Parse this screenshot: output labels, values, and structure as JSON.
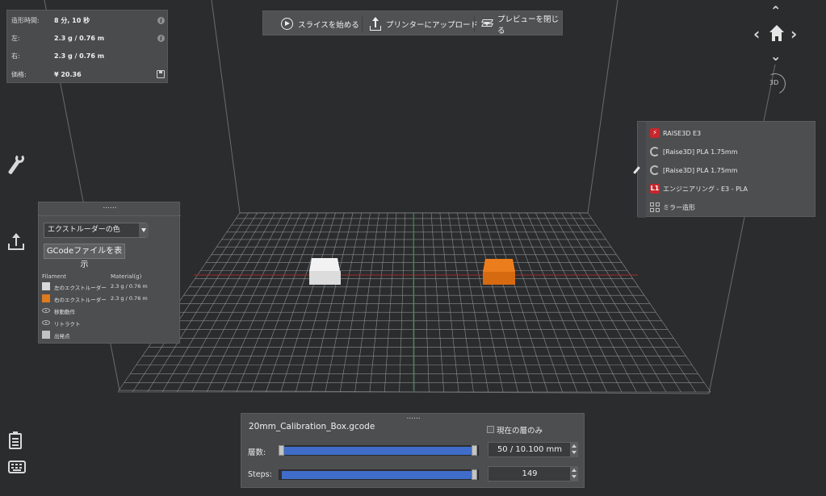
{
  "stats": {
    "rows": [
      {
        "label": "造形時間:",
        "value": "8 分, 10 秒",
        "icon": "info-icon"
      },
      {
        "label": "左:",
        "value": "2.3 g / 0.76 m",
        "icon": "info-icon"
      },
      {
        "label": "右:",
        "value": "2.3 g / 0.76 m",
        "icon": ""
      },
      {
        "label": "価格:",
        "value": "¥ 20.36",
        "icon": "save-icon"
      }
    ]
  },
  "toolbar": {
    "slice_label": "スライスを始める",
    "upload_label": "プリンターにアップロード",
    "close_preview_label": "プレビューを閉じる"
  },
  "profiles": {
    "printer": "RAISE3D E3",
    "left_filament": "[Raise3D] PLA 1.75mm",
    "right_filament": "[Raise3D] PLA 1.75mm",
    "template": "エンジニアリング - E3 - PLA",
    "template_badge": "L1",
    "mode": "ミラー造形"
  },
  "color_panel": {
    "drag_handle": "......",
    "dropdown_value": "エクストルーダーの色",
    "gcode_button": "GCodeファイルを表示",
    "header_filament": "Filament",
    "header_material": "Material(g)",
    "rows": [
      {
        "name": "左のエクストルーダー",
        "material": "2.3 g / 0.76 m",
        "swatch": "#d8d8d8"
      },
      {
        "name": "右のエクストルーダー",
        "material": "2.3 g / 0.76 m",
        "swatch": "#e07a1e"
      },
      {
        "name": "移動動作",
        "material": "",
        "swatch": "eye"
      },
      {
        "name": "リトラクト",
        "material": "",
        "swatch": "eye"
      },
      {
        "name": "出発点",
        "material": "",
        "swatch": "#c2c2c2"
      }
    ]
  },
  "layer_panel": {
    "drag_handle": "......",
    "filename": "20mm_Calibration_Box.gcode",
    "current_layer_only": "現在の層のみ",
    "layers_label": "層数:",
    "layers_value": "50 / 10.100 mm",
    "steps_label": "Steps:",
    "steps_value": "149"
  },
  "colors": {
    "accent_blue": "#3f6dc9",
    "orange": "#e07a1e",
    "brand_red": "#c8262d"
  }
}
